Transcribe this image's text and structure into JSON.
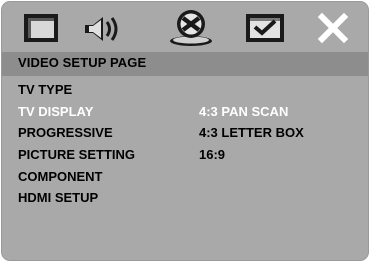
{
  "toolbar": {
    "icons": [
      {
        "name": "general-setup-icon"
      },
      {
        "name": "audio-setup-icon"
      },
      {
        "name": "video-setup-icon",
        "selected": true
      },
      {
        "name": "preference-setup-icon"
      },
      {
        "name": "exit-icon"
      }
    ]
  },
  "page": {
    "title": "VIDEO SETUP PAGE"
  },
  "menu": {
    "items": [
      {
        "label": "TV TYPE"
      },
      {
        "label": "TV DISPLAY",
        "active": true
      },
      {
        "label": "PROGRESSIVE"
      },
      {
        "label": "PICTURE SETTING"
      },
      {
        "label": "COMPONENT"
      },
      {
        "label": "HDMI SETUP"
      }
    ]
  },
  "options": {
    "items": [
      {
        "label": "4:3 PAN SCAN",
        "active": true
      },
      {
        "label": "4:3 LETTER BOX"
      },
      {
        "label": "16:9"
      }
    ]
  },
  "colors": {
    "background": "#a9a9a9",
    "title_bar": "#8d8d8d",
    "highlight_text": "#ffffff",
    "text": "#000000"
  }
}
